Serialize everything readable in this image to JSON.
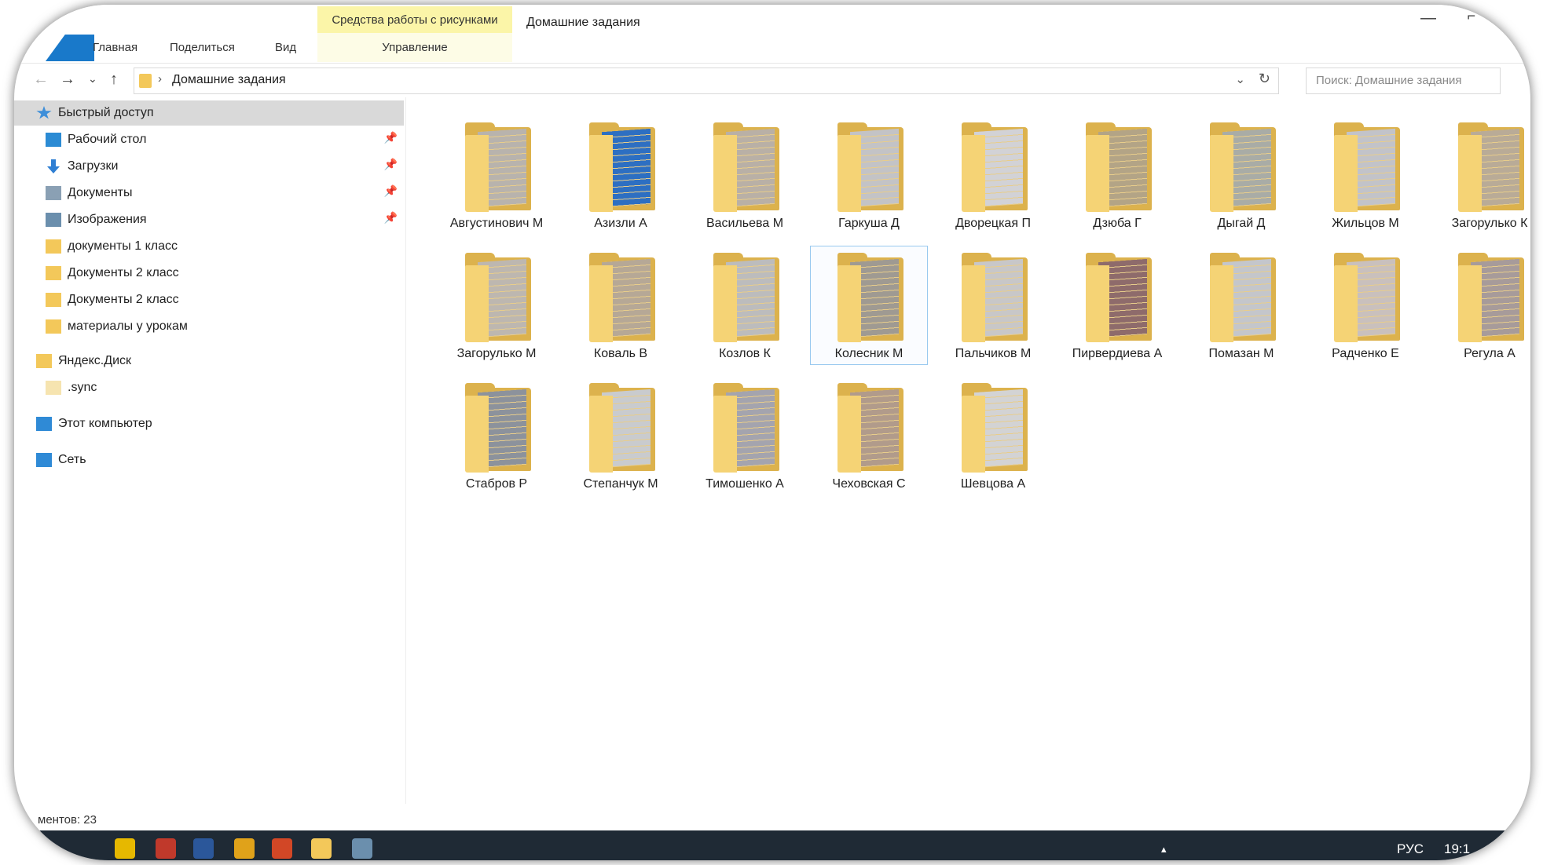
{
  "ribbon": {
    "tabs": [
      "Главная",
      "Поделиться",
      "Вид"
    ],
    "tools_header": "Средства работы с рисунками",
    "tools_tab": "Управление",
    "window_title": "Домашние задания",
    "minimize_glyph": "—",
    "maximize_glyph": "⌐"
  },
  "nav": {
    "back_glyph": "←",
    "forward_glyph": "→",
    "recent_glyph": "⌄",
    "up_glyph": "↑",
    "separator_glyph": "›",
    "path": "Домашние задания",
    "dropdown_glyph": "⌄",
    "refresh_glyph": "↻",
    "search_placeholder": "Поиск: Домашние задания"
  },
  "sidebar": {
    "pin_glyph": "📌",
    "items": [
      {
        "label": "Быстрый доступ",
        "icon": "star-icon",
        "color": "#3f8fd9"
      },
      {
        "label": "Рабочий стол",
        "icon": "desktop-icon",
        "color": "#2b8bd4"
      },
      {
        "label": "Загрузки",
        "icon": "download-icon",
        "color": "#2f7fd3"
      },
      {
        "label": "Документы",
        "icon": "documents-icon",
        "color": "#8aa0b4"
      },
      {
        "label": "Изображения",
        "icon": "pictures-icon",
        "color": "#6b8fad"
      },
      {
        "label": "документы 1 класс",
        "icon": "folder-icon",
        "color": "#f3c85a"
      },
      {
        "label": "Документы 2 класс",
        "icon": "folder-icon",
        "color": "#f3c85a"
      },
      {
        "label": "Документы 2 класс",
        "icon": "folder-icon",
        "color": "#f3c85a"
      },
      {
        "label": "материалы у урокам",
        "icon": "folder-icon",
        "color": "#f3c85a"
      },
      {
        "label": "Яндекс.Диск",
        "icon": "yandex-disk-icon",
        "color": "#f3c85a"
      },
      {
        "label": ".sync",
        "icon": "folder-icon",
        "color": "#f6e4b0"
      },
      {
        "label": "Этот компьютер",
        "icon": "computer-icon",
        "color": "#2f8ad6"
      },
      {
        "label": "Сеть",
        "icon": "network-icon",
        "color": "#2f8ad6"
      }
    ]
  },
  "folders": [
    {
      "name": "Августинович М",
      "paper": "#b8b3ad"
    },
    {
      "name": "Азизли А",
      "paper": "#2d6fc2"
    },
    {
      "name": "Васильева М",
      "paper": "#b9b0a6"
    },
    {
      "name": "Гаркуша Д",
      "paper": "#c3c3c6"
    },
    {
      "name": "Дворецкая П",
      "paper": "#d2d2d6"
    },
    {
      "name": "Дзюба Г",
      "paper": "#b3a486"
    },
    {
      "name": "Дыгай Д",
      "paper": "#a9aca6"
    },
    {
      "name": "Жильцов М",
      "paper": "#c2c3c9"
    },
    {
      "name": "Загорулько К",
      "paper": "#b9ab97"
    },
    {
      "name": "Загорулько М",
      "paper": "#bdb7b0"
    },
    {
      "name": "Коваль В",
      "paper": "#b6a896"
    },
    {
      "name": "Козлов К",
      "paper": "#bcbcbd"
    },
    {
      "name": "Колесник М",
      "paper": "#9f9a92"
    },
    {
      "name": "Пальчиков М",
      "paper": "#c8c7c8"
    },
    {
      "name": "Пирвердиева А",
      "paper": "#8e6b6b"
    },
    {
      "name": "Помазан М",
      "paper": "#c4c6cb"
    },
    {
      "name": "Радченко Е",
      "paper": "#c9c0bd"
    },
    {
      "name": "Регула А",
      "paper": "#a79b9a"
    },
    {
      "name": "Стабров Р",
      "paper": "#8c929c"
    },
    {
      "name": "Степанчук М",
      "paper": "#c9cbce"
    },
    {
      "name": "Тимошенко А",
      "paper": "#a4a4ae"
    },
    {
      "name": "Чеховская С",
      "paper": "#b19b8b"
    },
    {
      "name": "Шевцова А",
      "paper": "#d3d3d4"
    }
  ],
  "status": {
    "text": "ментов: 23"
  },
  "taskbar": {
    "apps": [
      {
        "name": "warning-app-icon",
        "color": "#e6b800"
      },
      {
        "name": "security-app-icon",
        "color": "#c0392b"
      },
      {
        "name": "word-app-icon",
        "color": "#2b579a"
      },
      {
        "name": "chrome-app-icon",
        "color": "#e0a21a"
      },
      {
        "name": "powerpoint-app-icon",
        "color": "#d24726"
      },
      {
        "name": "explorer-app-icon",
        "color": "#f3c85a"
      },
      {
        "name": "window-app-icon",
        "color": "#6b8fad"
      }
    ],
    "tray": {
      "chevron": "▴",
      "language": "РУС",
      "time": "19:1"
    }
  }
}
